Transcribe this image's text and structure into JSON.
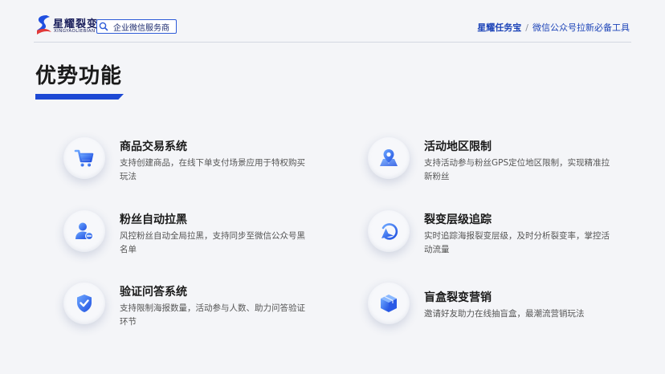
{
  "header": {
    "logo_name": "星耀裂变",
    "logo_sub": "XINGYAOLIEBIAN",
    "tag_label": "企业微信服务商",
    "brand": "星耀任务宝",
    "separator": "/",
    "slogan": "微信公众号拉新必备工具"
  },
  "page": {
    "title": "优势功能"
  },
  "features": [
    {
      "icon": "shopping-cart-icon",
      "title": "商品交易系统",
      "desc": "支持创建商品，在线下单支付场景应用于特权购买玩法"
    },
    {
      "icon": "map-location-icon",
      "title": "活动地区限制",
      "desc": "支持活动参与粉丝GPS定位地区限制，实现精准拉新粉丝"
    },
    {
      "icon": "user-block-icon",
      "title": "粉丝自动拉黑",
      "desc": "风控粉丝自动全局拉黑，支持同步至微信公众号黑名单"
    },
    {
      "icon": "tracking-arrow-icon",
      "title": "裂变层级追踪",
      "desc": "实时追踪海报裂变层级，及时分析裂变率，掌控活动流量"
    },
    {
      "icon": "shield-check-icon",
      "title": "验证问答系统",
      "desc": "支持限制海报数量，活动参与人数、助力问答验证环节"
    },
    {
      "icon": "blind-box-icon",
      "title": "盲盒裂变营销",
      "desc": "邀请好友助力在线抽盲盒，最潮流营销玩法"
    }
  ],
  "colors": {
    "accent": "#1d49d4",
    "icon_gradient_start": "#6ea8ff",
    "icon_gradient_end": "#1f4fe0"
  }
}
